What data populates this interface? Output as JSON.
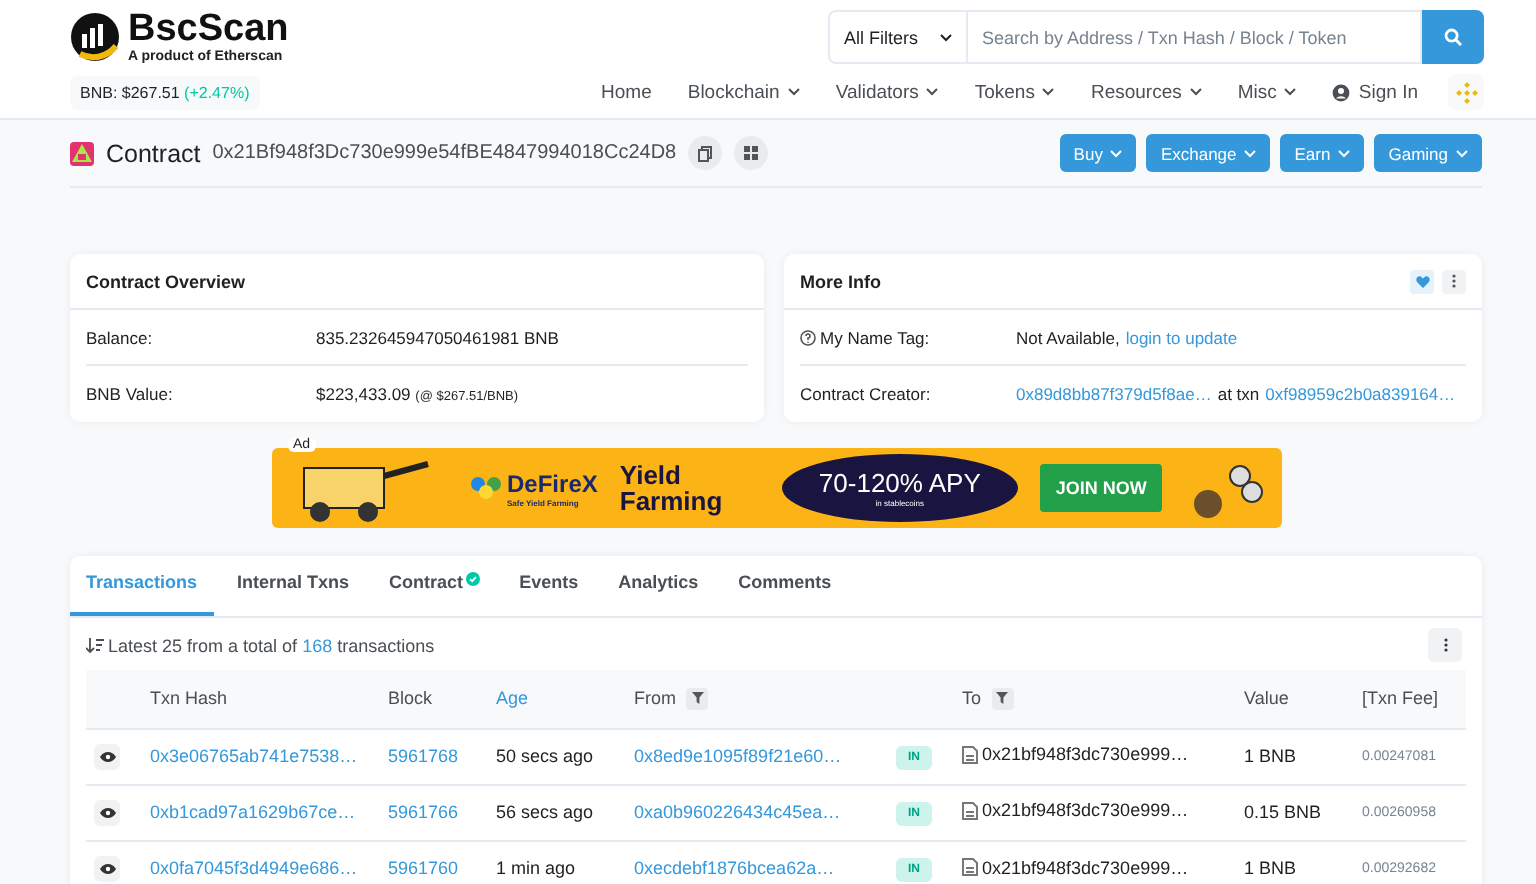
{
  "header": {
    "logo": {
      "name": "BscScan",
      "tagline": "A product of Etherscan"
    },
    "price": {
      "label": "BNB: $267.51",
      "change": "(+2.47%)"
    },
    "search": {
      "filter": "All Filters",
      "placeholder": "Search by Address / Txn Hash / Block / Token"
    },
    "nav": [
      {
        "label": "Home",
        "kind": "link"
      },
      {
        "label": "Blockchain",
        "kind": "menu"
      },
      {
        "label": "Validators",
        "kind": "menu"
      },
      {
        "label": "Tokens",
        "kind": "menu"
      },
      {
        "label": "Resources",
        "kind": "menu"
      },
      {
        "label": "Misc",
        "kind": "menu"
      },
      {
        "label": "Sign In",
        "kind": "signin"
      }
    ]
  },
  "contract": {
    "title": "Contract",
    "address": "0x21Bf948f3Dc730e999e54fBE4847994018Cc24D8",
    "actions": [
      {
        "label": "Buy"
      },
      {
        "label": "Exchange"
      },
      {
        "label": "Earn"
      },
      {
        "label": "Gaming"
      }
    ]
  },
  "overview": {
    "title": "Contract Overview",
    "rows": [
      {
        "label": "Balance:",
        "value": "835.232645947050461981 BNB"
      },
      {
        "label": "BNB Value:",
        "value": "$223,433.09",
        "note": "(@ $267.51/BNB)"
      }
    ]
  },
  "more_info": {
    "title": "More Info",
    "name_tag": {
      "label": "My Name Tag:",
      "value": "Not Available,",
      "link": "login to update"
    },
    "creator": {
      "label": "Contract Creator:",
      "address": "0x89d8bb87f379d5f8ae…",
      "connector": "at txn",
      "txn": "0xf98959c2b0a839164…"
    }
  },
  "ad": {
    "label": "Ad",
    "brand": "DeFireX",
    "tagline": "Safe Yield Farming",
    "headline": "Yield Farming",
    "offer": "70-120% APY",
    "offer_note": "in stablecoins",
    "cta": "JOIN NOW"
  },
  "tabs": [
    {
      "label": "Transactions",
      "selected": true,
      "verified": false
    },
    {
      "label": "Internal Txns",
      "selected": false,
      "verified": false
    },
    {
      "label": "Contract",
      "selected": false,
      "verified": true
    },
    {
      "label": "Events",
      "selected": false,
      "verified": false
    },
    {
      "label": "Analytics",
      "selected": false,
      "verified": false
    },
    {
      "label": "Comments",
      "selected": false,
      "verified": false
    }
  ],
  "summary": {
    "prefix": "Latest 25 from a total of",
    "count": "168",
    "suffix": "transactions"
  },
  "table": {
    "columns": [
      {
        "label": "Txn Hash",
        "active": false,
        "filter": false
      },
      {
        "label": "Block",
        "active": false,
        "filter": false
      },
      {
        "label": "Age",
        "active": true,
        "filter": false
      },
      {
        "label": "From",
        "active": false,
        "filter": true
      },
      {
        "label": "To",
        "active": false,
        "filter": true
      },
      {
        "label": "Value",
        "active": false,
        "filter": false
      },
      {
        "label": "[Txn Fee]",
        "active": false,
        "filter": false
      }
    ],
    "rows": [
      {
        "hash": "0x3e06765ab741e7538…",
        "block": "5961768",
        "age": "50 secs ago",
        "from": "0x8ed9e1095f89f21e60…",
        "direction": "IN",
        "to": "0x21bf948f3dc730e999…",
        "value": "1 BNB",
        "fee": "0.00247081"
      },
      {
        "hash": "0xb1cad97a1629b67ce…",
        "block": "5961766",
        "age": "56 secs ago",
        "from": "0xa0b960226434c45ea…",
        "direction": "IN",
        "to": "0x21bf948f3dc730e999…",
        "value": "0.15 BNB",
        "fee": "0.00260958"
      },
      {
        "hash": "0x0fa7045f3d4949e686…",
        "block": "5961760",
        "age": "1 min ago",
        "from": "0xecdebf1876bcea62a…",
        "direction": "IN",
        "to": "0x21bf948f3dc730e999…",
        "value": "1 BNB",
        "fee": "0.00292682"
      }
    ]
  }
}
